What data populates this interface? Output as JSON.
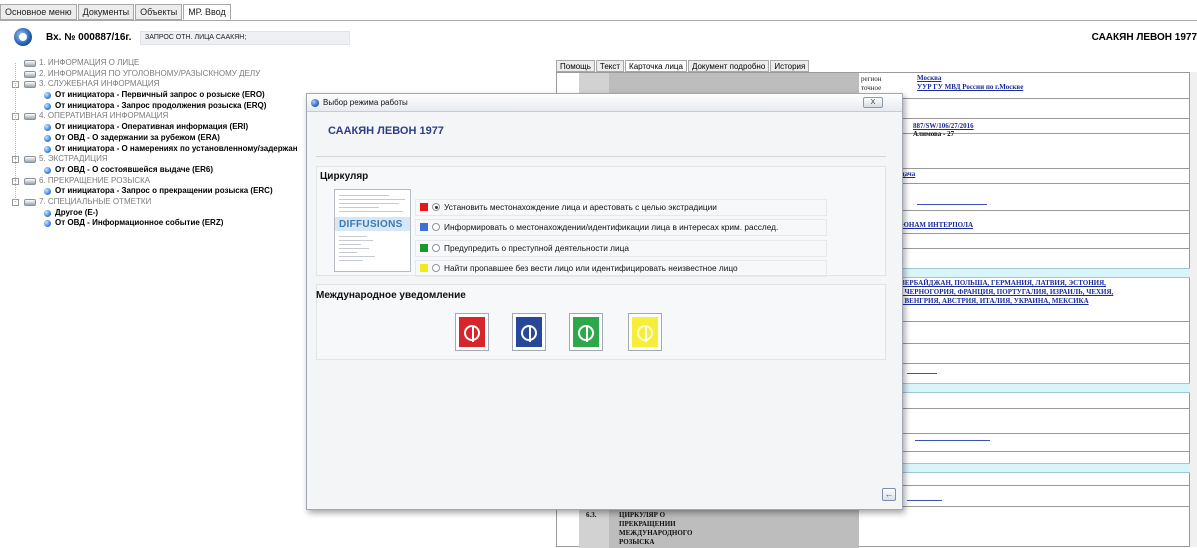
{
  "top_tabs": [
    {
      "label": "Основное меню"
    },
    {
      "label": "Документы"
    },
    {
      "label": "Объекты"
    },
    {
      "label": "МР. Ввод"
    }
  ],
  "header": {
    "doc_number": "Вх. № 000887/16г.",
    "doc_desc": "ЗАПРОС ОТН. ЛИЦА СААКЯН;",
    "person": "СААКЯН ЛЕВОН 1977"
  },
  "tree": [
    {
      "level": 1,
      "label": "1. ИНФОРМАЦИЯ О ЛИЦЕ",
      "expander": "",
      "icon": "folder-icon"
    },
    {
      "level": 1,
      "label": "2. ИНФОРМАЦИЯ ПО УГОЛОВНОМУ/РАЗЫСКНОМУ ДЕЛУ",
      "expander": "",
      "icon": "folder-icon"
    },
    {
      "level": 1,
      "label": "3. СЛУЖЕБНАЯ ИНФОРМАЦИЯ",
      "expander": "-",
      "icon": "folder-icon"
    },
    {
      "level": 2,
      "label": "От инициатора - Первичный запрос о розыске (ERO)",
      "icon": "bullet-icon"
    },
    {
      "level": 2,
      "label": "От инициатора - Запрос продолжения розыска (ERQ)",
      "icon": "bullet-icon"
    },
    {
      "level": 1,
      "label": "4. ОПЕРАТИВНАЯ ИНФОРМАЦИЯ",
      "expander": "-",
      "icon": "folder-icon"
    },
    {
      "level": 2,
      "label": "От инициатора - Оперативная информация (ERI)",
      "icon": "bullet-icon"
    },
    {
      "level": 2,
      "label": "От ОВД - О задержании за рубежом (ERA)",
      "icon": "bullet-icon"
    },
    {
      "level": 2,
      "label": "От инициатора - О намерениях по установленному/задержан",
      "icon": "bullet-icon"
    },
    {
      "level": 1,
      "label": "5. ЭКСТРАДИЦИЯ",
      "expander": "-",
      "icon": "folder-icon"
    },
    {
      "level": 2,
      "label": "От ОВД - О состоявшейся выдаче (ER6)",
      "icon": "bullet-icon"
    },
    {
      "level": 1,
      "label": "6. ПРЕКРАЩЕНИЕ РОЗЫСКА",
      "expander": "-",
      "icon": "folder-icon"
    },
    {
      "level": 2,
      "label": "От инициатора - Запрос о прекращении розыска (ERC)",
      "icon": "bullet-icon"
    },
    {
      "level": 1,
      "label": "7. СПЕЦИАЛЬНЫЕ ОТМЕТКИ",
      "expander": "-",
      "icon": "folder-icon"
    },
    {
      "level": 2,
      "label": "Другое (E-)",
      "icon": "bullet-icon"
    },
    {
      "level": 2,
      "label": "От ОВД - Информационное событие  (ERZ)",
      "icon": "bullet-icon"
    }
  ],
  "right_tabs": [
    {
      "label": "Помощь"
    },
    {
      "label": "Текст"
    },
    {
      "label": "Карточка лица",
      "active": true
    },
    {
      "label": "Документ подробно"
    },
    {
      "label": "История"
    }
  ],
  "card": {
    "region_label": "регион",
    "region_value": "Москва",
    "exact_label": "точное",
    "exact_value": "УУР ГУ МВД России по г.Москве",
    "ref_number": "887/SW/106/27/2016",
    "officer": "Алимова - 27",
    "partial_1": "дача",
    "partial_2": "ЮНАМ ИНТЕРПОЛА",
    "countries_1": "ЗЕРБАЙДЖАН, ПОЛЬША, ГЕРМАНИЯ, ЛАТВИЯ, ЭСТОНИЯ,",
    "countries_2": ", ЧЕРНОГОРИЯ, ФРАНЦИЯ, ПОРТУГАЛИЯ, ИЗРАИЛЬ, ЧЕХИЯ,",
    "countries_3": ", ВЕНГРИЯ, АВСТРИЯ, ИТАЛИЯ, УКРАИНА, МЕКСИКА",
    "section_num": "6.3.",
    "section_l1": "ЦИРКУЛЯР О",
    "section_l2": "ПРЕКРАЩЕНИИ",
    "section_l3": "МЕЖДУНАРОДНОГО",
    "section_l4": "РОЗЫСКА"
  },
  "dialog": {
    "title": "Выбор режима работы",
    "close_label": "X",
    "person": "СААКЯН ЛЕВОН 1977",
    "circular_title": "Циркуляр",
    "doc_image_text": "DIFFUSIONS",
    "options": [
      {
        "label": "Установить местонахождение лица и арестовать с целью экстрадиции",
        "color": "#e8141b",
        "selected": true
      },
      {
        "label": "Информировать о местонахождении/идентификации лица в интересах крим. расслед.",
        "color": "#3b6fd6",
        "selected": false
      },
      {
        "label": "Предупредить о преступной деятельности лица",
        "color": "#159a2e",
        "selected": false
      },
      {
        "label": "Найти пропавшее без вести лицо или идентифицировать неизвестное лицо",
        "color": "#f4ea1a",
        "selected": false
      }
    ],
    "intl_title": "Международное уведомление",
    "notices": [
      {
        "name": "red",
        "color": "#d7262b"
      },
      {
        "name": "blue",
        "color": "#27479a"
      },
      {
        "name": "green",
        "color": "#2ea84a"
      },
      {
        "name": "yellow",
        "color": "#f6ee3a"
      }
    ]
  }
}
